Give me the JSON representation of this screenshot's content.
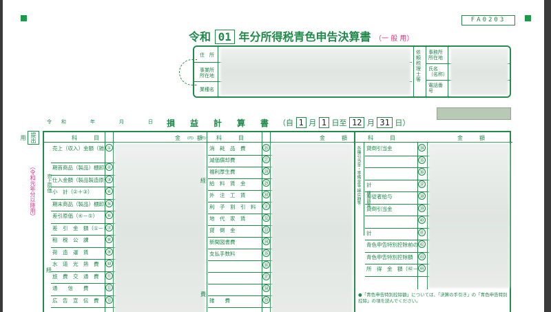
{
  "form_id": "FA0203",
  "title": {
    "prefix": "令和",
    "year": "01",
    "main": "年分所得税青色申告決算書",
    "sub": "（一 般 用）"
  },
  "address_box": {
    "labels": [
      "住　所",
      "事業所所在地",
      "業種名"
    ],
    "right_labels": [
      "依頼税理士等",
      "事務所所在地",
      "氏名（名称）",
      "電話番号"
    ]
  },
  "date_line": "令和　年　月　日",
  "pl_title": "損益計算書",
  "period": {
    "from_label": "（自",
    "from_month": "1",
    "from_day": "1",
    "to_label": "日至",
    "to_month": "12",
    "to_day": "31",
    "month_unit": "月",
    "day_unit": "日",
    "end": "日）"
  },
  "side": {
    "box": "提出用",
    "note": "（令和元年分以降用）"
  },
  "headers": {
    "item": "科　目",
    "amount": "金　額",
    "yen": "(円)"
  },
  "col1": [
    {
      "label": "売上（収入）金額（雑収入を含む）",
      "no": "①"
    },
    {
      "label": "期首商品（製品）棚卸高",
      "no": "②"
    },
    {
      "label": "仕入金額（製品製造原価）",
      "no": "③"
    },
    {
      "label": "小　計（②＋③）",
      "no": "④"
    },
    {
      "label": "期末商品（製品）棚卸高",
      "no": "⑤"
    },
    {
      "label": "差引原価（④－⑤）",
      "no": "⑥"
    },
    {
      "label": "差　引　金　額（①－⑥）",
      "no": "⑦"
    },
    {
      "label": "租　税　公　課",
      "no": "⑧"
    },
    {
      "label": "荷　造　運　賃",
      "no": "⑨"
    },
    {
      "label": "水　道　光　熱　費",
      "no": "⑩"
    },
    {
      "label": "旅　費　交　通　費",
      "no": "⑪"
    },
    {
      "label": "通　　信　　費",
      "no": "⑫"
    },
    {
      "label": "広　告　宣　伝　費",
      "no": "⑬"
    }
  ],
  "col1_group": {
    "genka": "売上原価",
    "keihi": "経"
  },
  "col2": [
    {
      "label": "消　耗　品　費",
      "no": "㉖"
    },
    {
      "label": "減価償却費",
      "no": "㉗"
    },
    {
      "label": "福利厚生費",
      "no": "㉘"
    },
    {
      "label": "給　料　賃　金",
      "no": "㉙"
    },
    {
      "label": "外　注　工　賃",
      "no": "㉚"
    },
    {
      "label": "利　子　割　引　料",
      "no": "㉛"
    },
    {
      "label": "地　代　家　賃",
      "no": "㉜"
    },
    {
      "label": "貸　倒　金",
      "no": "㉝"
    },
    {
      "label": "新聞図書費",
      "no": "㉞"
    },
    {
      "label": "支払手数料",
      "no": "㉟"
    },
    {
      "label": "",
      "no": "㊱"
    },
    {
      "label": "",
      "no": "㊲"
    },
    {
      "label": "",
      "no": "㊳"
    },
    {
      "label": "雑　　費",
      "no": "㊴"
    }
  ],
  "col2_group": {
    "hi": "費"
  },
  "col3": [
    {
      "label": "貸倒引当金",
      "no": "㉞"
    },
    {
      "label": "",
      "no": "㉟"
    },
    {
      "label": "",
      "no": "㊱"
    },
    {
      "label": "計",
      "no": "㊲"
    },
    {
      "label": "専従者給与",
      "no": "㊳"
    },
    {
      "label": "貸倒引当金",
      "no": "㊴"
    },
    {
      "label": "",
      "no": "㊵"
    },
    {
      "label": "計",
      "no": "㊶"
    },
    {
      "label": "青色申告特別控除前の所得金額（㉝＋㊲－㊶）",
      "no": "㊷"
    },
    {
      "label": "青色申告特別控除額",
      "no": "㊸"
    },
    {
      "label": "所　得　金　額（㊷－㊸）",
      "no": "㊹"
    }
  ],
  "col3_group": {
    "kuri": "各種引当金・準備金等 繰戻額等",
    "kuriire": "繰入額等"
  },
  "note": "●「青色申告特別控除額」については、「決算の手引き」の「青色申告特別控除」の項を読んでください。"
}
